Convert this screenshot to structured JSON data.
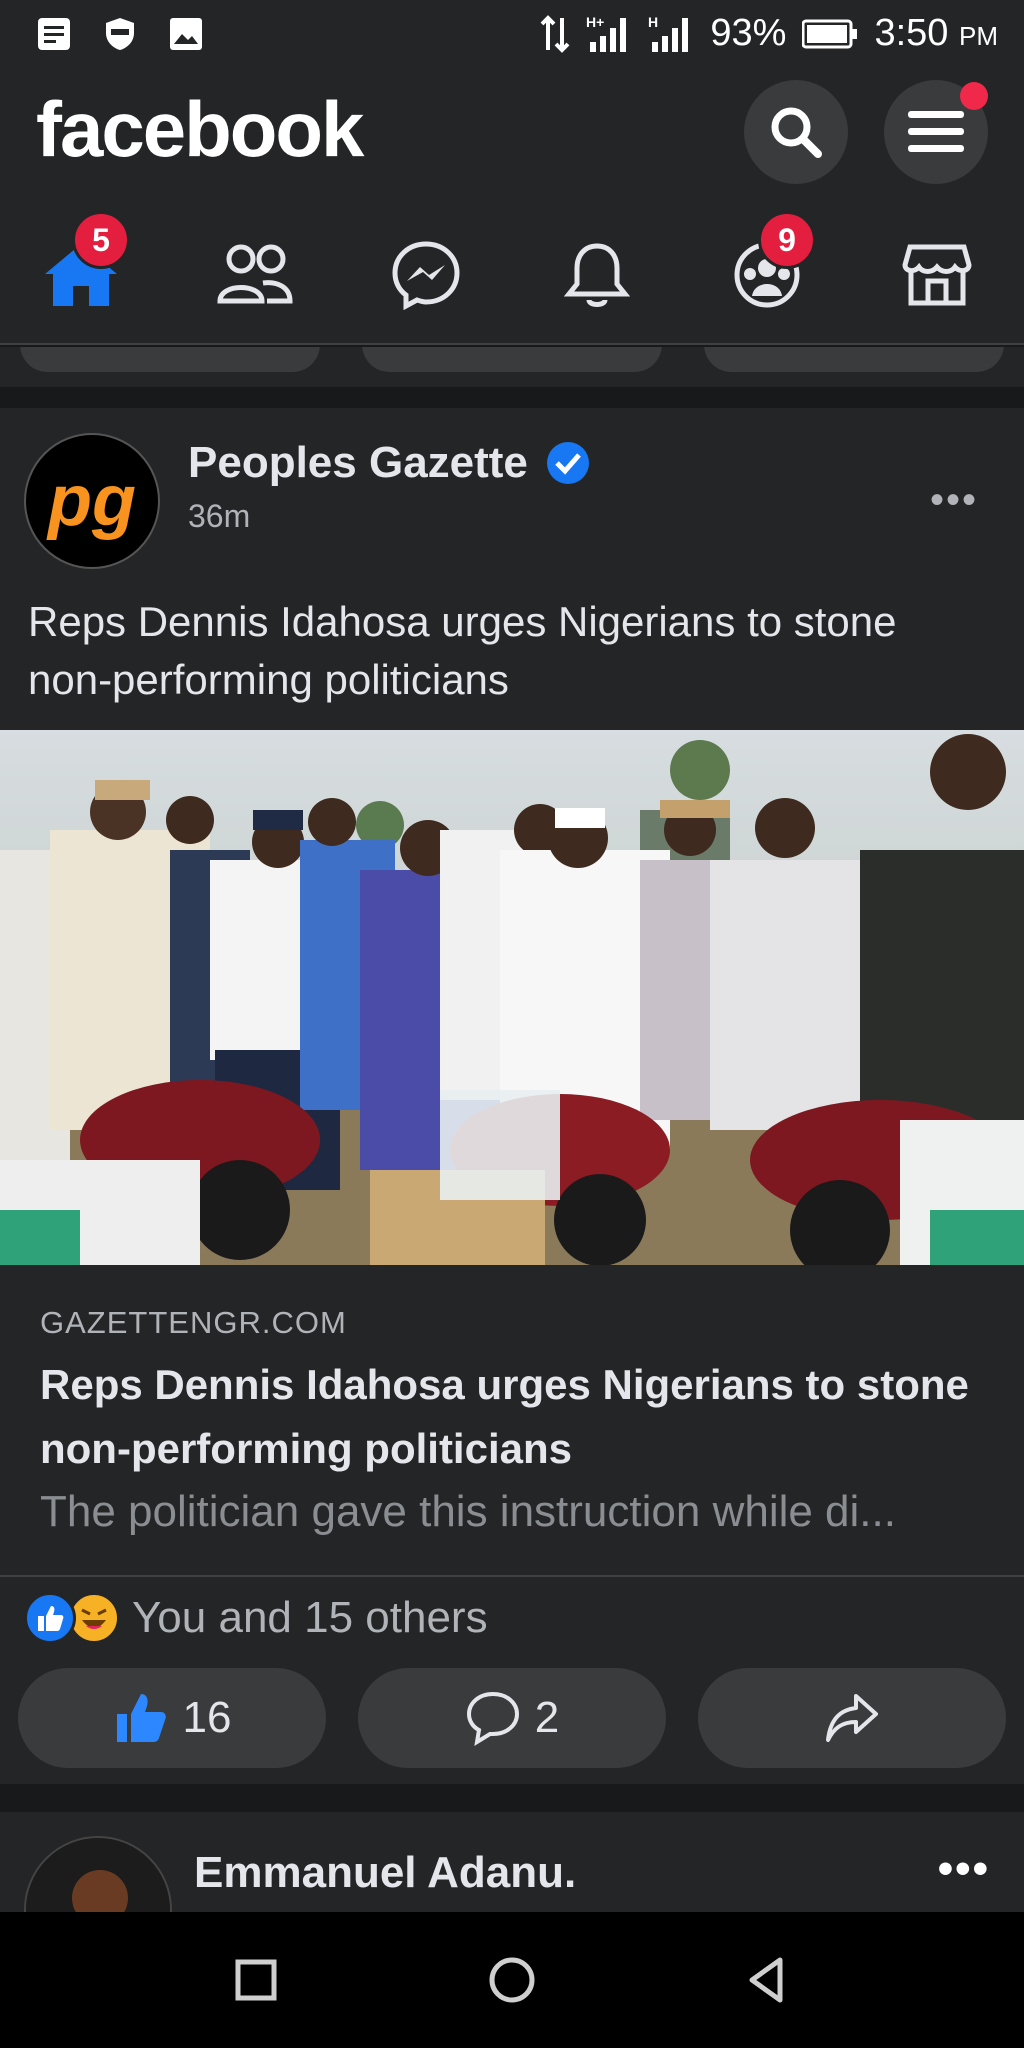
{
  "status_bar": {
    "network": "H+",
    "network2": "H",
    "battery": "93%",
    "time": "3:50",
    "ampm": "PM"
  },
  "top_bar": {
    "app_title": "facebook"
  },
  "nav": {
    "home_badge": "5",
    "groups_badge": "9"
  },
  "post": {
    "author": "Peoples Gazette",
    "avatar_text": "pg",
    "time": "36m",
    "more": "•••",
    "text": "Reps Dennis Idahosa urges Nigerians to stone non-performing politicians",
    "link": {
      "domain": "GAZETTENGR.COM",
      "title": "Reps Dennis Idahosa urges Nigerians to stone non-performing politicians",
      "description": "The politician gave this instruction while di..."
    },
    "reactions_text": "You and 15 others",
    "like_count": "16",
    "comment_count": "2"
  },
  "next_post": {
    "author": "Emmanuel Adanu.",
    "more": "•••"
  },
  "colors": {
    "brand_blue": "#1877f2",
    "badge_red": "#e41e3f",
    "background": "#18191a",
    "card": "#242526"
  }
}
